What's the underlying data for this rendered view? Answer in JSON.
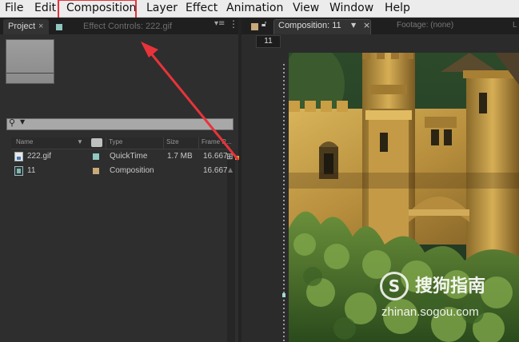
{
  "menubar": {
    "items": [
      "File",
      "Edit",
      "Composition",
      "Layer",
      "Effect",
      "Animation",
      "View",
      "Window",
      "Help"
    ],
    "highlighted": "Composition",
    "highlight_color": "#e8333a"
  },
  "project_panel": {
    "tabs": {
      "project": "Project",
      "project_close": "×",
      "effect_controls": "Effect Controls: 222.gif"
    },
    "search_icon": "magnifier-icon",
    "columns": {
      "name": "Name",
      "sort": "▼",
      "type": "Type",
      "size": "Size",
      "frame_rate": "Frame R..."
    },
    "items": [
      {
        "name": "222.gif",
        "type": "QuickTime",
        "size": "1.7 MB",
        "frame_rate": "16.667",
        "label_color": "#8fc7c2",
        "icon": "gif-file-icon"
      },
      {
        "name": "11",
        "type": "Composition",
        "size": "",
        "frame_rate": "16.667",
        "label_color": "#c9a97a",
        "icon": "composition-icon"
      }
    ]
  },
  "composition_panel": {
    "tab_label": "Composition: 11",
    "tab_close": "×",
    "footage_tab": "Footage: (none)",
    "more_tab": "L",
    "comp_chip": "11",
    "comp_color": "#c9a97a"
  },
  "watermark": {
    "cn": "搜狗指南",
    "en": "zhinan.sogou.com",
    "logo": "S"
  },
  "annotation": {
    "arrow_color": "#e8333a"
  }
}
